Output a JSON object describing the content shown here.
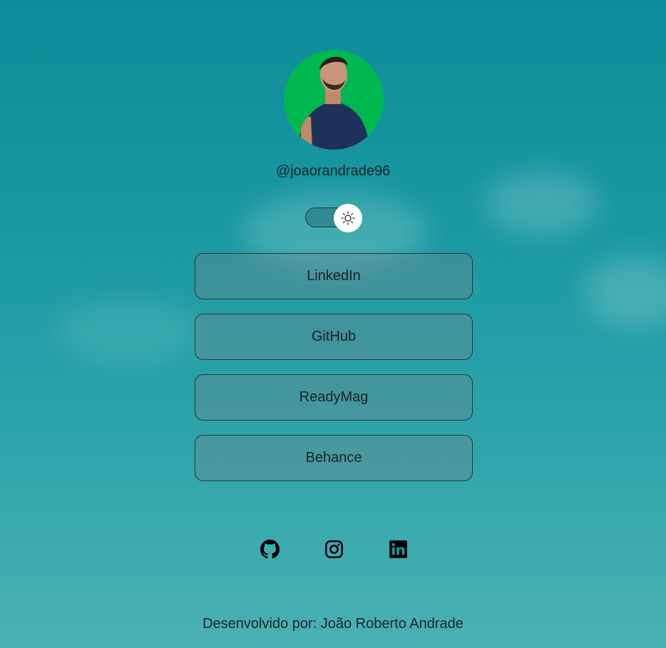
{
  "profile": {
    "username": "@joaorandrade96",
    "avatar_bg": "#00b84f"
  },
  "theme_toggle": {
    "icon": "sun-icon",
    "state": "light"
  },
  "links": [
    {
      "label": "LinkedIn"
    },
    {
      "label": "GitHub"
    },
    {
      "label": "ReadyMag"
    },
    {
      "label": "Behance"
    }
  ],
  "social": [
    {
      "icon": "github-icon"
    },
    {
      "icon": "instagram-icon"
    },
    {
      "icon": "linkedin-icon"
    }
  ],
  "footer": {
    "text": "Desenvolvido por: João Roberto Andrade"
  },
  "colors": {
    "background": "#1a98a2",
    "avatar_bg": "#00b84f",
    "button_border": "#25393c",
    "text": "#1c2426"
  }
}
